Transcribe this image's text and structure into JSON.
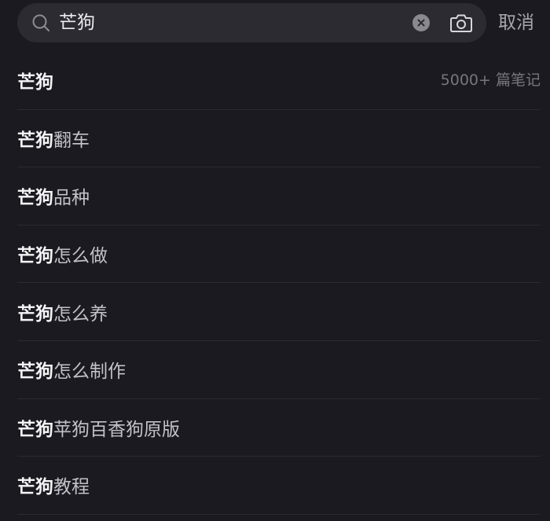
{
  "search": {
    "query": "芒狗",
    "cancel_label": "取消"
  },
  "icons": {
    "search": "search-icon",
    "clear": "clear-icon",
    "camera": "camera-icon"
  },
  "colors": {
    "background": "#1b1a20",
    "search_bar": "#2c2b32",
    "highlight_text": "#f4f4f6",
    "suggestion_text": "#c2c1c7",
    "muted_text": "#77767d"
  },
  "suggestions": [
    {
      "keyword": "芒狗",
      "rest": "",
      "count": "5000+ 篇笔记"
    },
    {
      "keyword": "芒狗",
      "rest": "翻车"
    },
    {
      "keyword": "芒狗",
      "rest": "品种"
    },
    {
      "keyword": "芒狗",
      "rest": "怎么做"
    },
    {
      "keyword": "芒狗",
      "rest": "怎么养"
    },
    {
      "keyword": "芒狗",
      "rest": "怎么制作"
    },
    {
      "keyword": "芒狗",
      "rest": "苹狗百香狗原版"
    },
    {
      "keyword": "芒狗",
      "rest": "教程"
    }
  ]
}
